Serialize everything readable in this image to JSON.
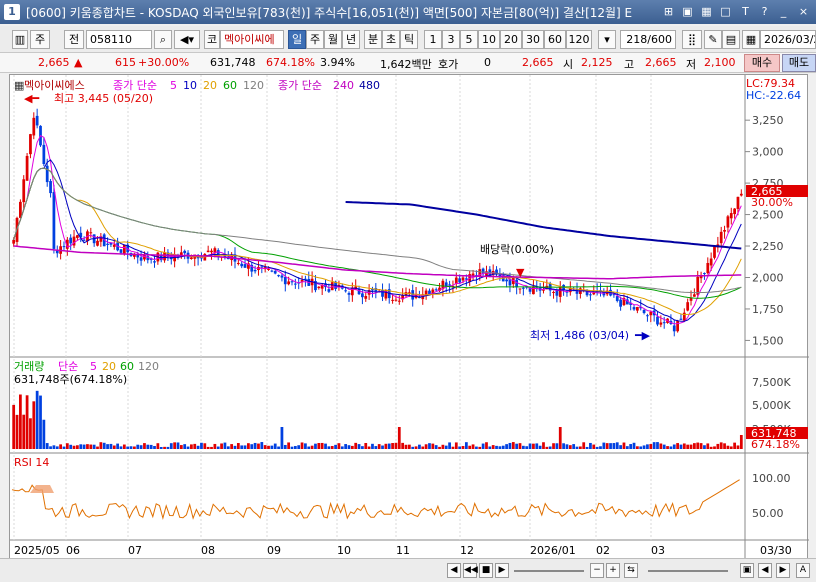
{
  "title": {
    "icon": "1",
    "text": "[0600] 키움종합차트 - KOSDAQ 외국인보유[783(천)] 주식수[16,051(천)] 액면[500] 자본금[80(억)] 결산[12월] E",
    "icons": [
      "link-icon",
      "restore-icon",
      "tile-icon",
      "maximize-icon",
      "text-icon",
      "help-icon",
      "minimize-icon",
      "close-icon"
    ],
    "icon_glyphs": [
      "⊞",
      "▣",
      "▦",
      "□",
      "T",
      "?",
      "_",
      "×"
    ]
  },
  "toolbar": {
    "type_label": "주",
    "all_label": "전",
    "stock_code": "058110",
    "stock_name": "멕아이씨에",
    "name_prefix": "코",
    "periods": [
      "일",
      "주",
      "월",
      "년",
      "분",
      "초",
      "틱"
    ],
    "selected_period": "일",
    "intervals": [
      "1",
      "3",
      "5",
      "10",
      "20",
      "30",
      "60",
      "120"
    ],
    "count": "218/600",
    "date": "2026/03/2"
  },
  "info": {
    "price": "2,665",
    "change": "615",
    "change_pct": "+30.00%",
    "volume": "631,748",
    "vol_pct": "674.18%",
    "ratio": "3.94%",
    "amount": "1,642백만",
    "quote_label": "호가",
    "quote_value": "0",
    "current": "2,665",
    "open_label": "시",
    "open": "2,125",
    "high_label": "고",
    "high": "2,665",
    "low_label": "저",
    "low": "2,100",
    "buy": "매수",
    "sell": "매도"
  },
  "legend": {
    "stock_name": "멕아이씨에스",
    "ma_label": "종가 단순",
    "ma_periods": [
      "5",
      "10",
      "20",
      "60",
      "120"
    ],
    "ma2_label": "종가 단순",
    "ma2_periods": [
      "240",
      "480"
    ],
    "lc": "LC:79.34",
    "hc": "HC:-22.64"
  },
  "annotations": {
    "high": "최고 3,445 (05/20)",
    "low": "최저 1,486 (03/04)",
    "dividend": "배당락(0.00%)"
  },
  "price_axis": {
    "ticks": [
      "3,250",
      "3,000",
      "2,750",
      "2,500",
      "2,250",
      "2,000",
      "1,750",
      "1,500"
    ],
    "last_price": "2,665",
    "last_pct": "30.00%"
  },
  "volume_panel": {
    "label": "거래량",
    "ma_label": "단순",
    "ma_periods": [
      "5",
      "20",
      "60",
      "120"
    ],
    "current": "631,748주(674.18%)",
    "ticks": [
      "7,500K",
      "5,000K",
      "2,500K"
    ],
    "last_value": "631,748",
    "last_pct": "674.18%"
  },
  "rsi_panel": {
    "label": "RSI 14",
    "ticks": [
      "100.00",
      "50.00"
    ]
  },
  "x_axis": {
    "labels": [
      "2025/05",
      "06",
      "07",
      "08",
      "09",
      "10",
      "11",
      "12",
      "2026/01",
      "02",
      "03"
    ],
    "end_label": "03/30"
  },
  "colors": {
    "up": "#e00000",
    "down": "#0040e0",
    "ma5": "#e000e0",
    "ma10": "#0000c0",
    "ma20": "#e0a000",
    "ma60": "#00a000",
    "ma120": "#808080",
    "ma240": "#c000c0",
    "ma480": "#0000a0"
  },
  "chart_data": {
    "type": "line",
    "title": "",
    "series": [
      {
        "name": "종가",
        "x": [
          "2025/05",
          "2025/06",
          "2025/07",
          "2025/08",
          "2025/09",
          "2025/10",
          "2025/11",
          "2025/12",
          "2026/01",
          "2026/02",
          "2026/03",
          "2026/03/30"
        ],
        "values": [
          2000,
          2350,
          2150,
          2200,
          2000,
          1900,
          1850,
          2050,
          1900,
          1850,
          1600,
          2665
        ]
      },
      {
        "name": "240",
        "values": [
          2250,
          2200,
          2180,
          2170,
          2120,
          2060,
          2030,
          2010,
          2000,
          1990,
          2010,
          2020
        ]
      },
      {
        "name": "480",
        "values": [
          null,
          null,
          null,
          null,
          null,
          2600,
          2580,
          2500,
          2400,
          2330,
          2280,
          2230
        ]
      }
    ],
    "ylim": [
      1400,
      3450
    ],
    "high": {
      "value": 3445,
      "date": "05/20"
    },
    "low": {
      "value": 1486,
      "date": "03/04"
    }
  }
}
